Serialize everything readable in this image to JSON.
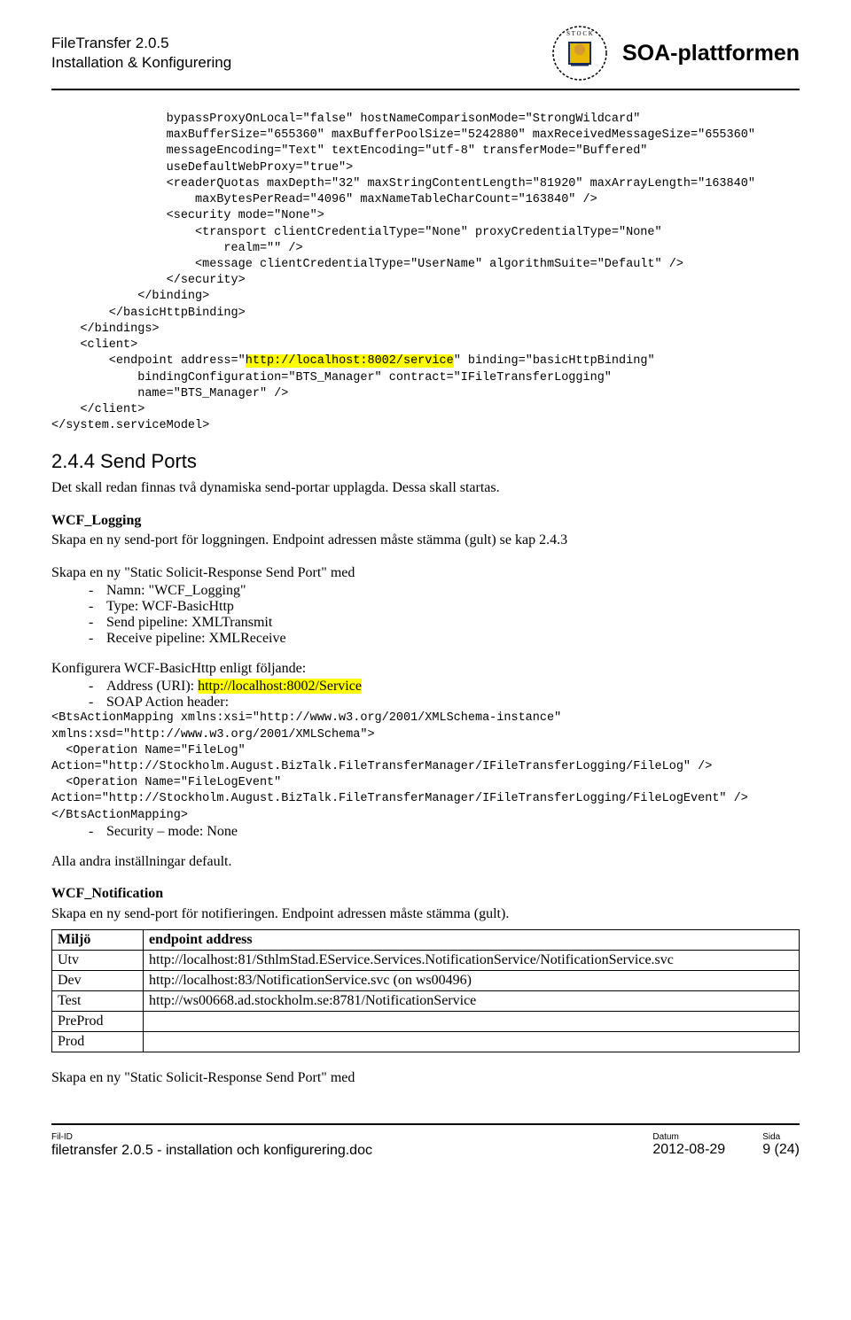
{
  "header": {
    "title_line1": "FileTransfer 2.0.5",
    "title_line2": "Installation & Konfigurering",
    "platform": "SOA-plattformen"
  },
  "code": {
    "pre1": "                bypassProxyOnLocal=\"false\" hostNameComparisonMode=\"StrongWildcard\"\n                maxBufferSize=\"655360\" maxBufferPoolSize=\"5242880\" maxReceivedMessageSize=\"655360\"\n                messageEncoding=\"Text\" textEncoding=\"utf-8\" transferMode=\"Buffered\"\n                useDefaultWebProxy=\"true\">\n                <readerQuotas maxDepth=\"32\" maxStringContentLength=\"81920\" maxArrayLength=\"163840\"\n                    maxBytesPerRead=\"4096\" maxNameTableCharCount=\"163840\" />\n                <security mode=\"None\">\n                    <transport clientCredentialType=\"None\" proxyCredentialType=\"None\"\n                        realm=\"\" />\n                    <message clientCredentialType=\"UserName\" algorithmSuite=\"Default\" />\n                </security>\n            </binding>\n        </basicHttpBinding>\n    </bindings>\n    <client>\n        <endpoint address=\"",
    "endpoint_hl": "http://localhost:8002/service",
    "post1": "\" binding=\"basicHttpBinding\"\n            bindingConfiguration=\"BTS_Manager\" contract=\"IFileTransferLogging\"\n            name=\"BTS_Manager\" />\n    </client>\n</system.serviceModel>"
  },
  "section_244": {
    "heading": "2.4.4   Send Ports",
    "intro": "Det skall redan finnas två dynamiska send-portar upplagda. Dessa skall startas.",
    "wcf_logging_title": "WCF_Logging",
    "wcf_logging_sub": "Skapa en ny send-port för loggningen. Endpoint adressen måste stämma (gult) se kap 2.4.3",
    "solicit_intro": "Skapa en ny \"Static Solicit-Response Send Port\" med",
    "bullets1": {
      "b1": "Namn: \"WCF_Logging\"",
      "b2": "Type: WCF-BasicHttp",
      "b3": "Send pipeline: XMLTransmit",
      "b4": "Receive pipeline: XMLReceive"
    },
    "konfig_title": "Konfigurera WCF-BasicHttp enligt följande:",
    "addr_label": "Address (URI): ",
    "addr_hl": "http://localhost:8002/Service",
    "soap_label": "SOAP Action header:",
    "soap_xml_1": "<BtsActionMapping xmlns:xsi=\"http://www.w3.org/2001/XMLSchema-instance\"\nxmlns:xsd=\"http://www.w3.org/2001/XMLSchema\">\n  <Operation Name=\"FileLog\"\nAction=\"http://Stockholm.August.BizTalk.FileTransferManager/IFileTransferLogging/FileLog\" />\n  <Operation Name=\"FileLogEvent\"\nAction=\"http://Stockholm.August.BizTalk.FileTransferManager/IFileTransferLogging/FileLogEvent\" />\n</BtsActionMapping>",
    "security_line": "Security – mode: None",
    "alla_default": "Alla andra inställningar default.",
    "wcf_notif_title": "WCF_Notification",
    "wcf_notif_sub": "Skapa en ny send-port för notifieringen. Endpoint adressen måste stämma (gult).",
    "table": {
      "col1": "Miljö",
      "col2": "endpoint address",
      "rows": [
        {
          "env": "Utv",
          "addr": "http://localhost:81/SthlmStad.EService.Services.NotificationService/NotificationService.svc"
        },
        {
          "env": "Dev",
          "addr": "http://localhost:83/NotificationService.svc (on ws00496)"
        },
        {
          "env": "Test",
          "addr": "http://ws00668.ad.stockholm.se:8781/NotificationService"
        },
        {
          "env": "PreProd",
          "addr": ""
        },
        {
          "env": "Prod",
          "addr": ""
        }
      ]
    },
    "solicit_outro": "Skapa en ny \"Static Solicit-Response Send Port\" med"
  },
  "footer": {
    "filid_label": "Fil-ID",
    "filename": "filetransfer 2.0.5 - installation och konfigurering.doc",
    "datum_label": "Datum",
    "datum": "2012-08-29",
    "sida_label": "Sida",
    "sida": "9 (24)"
  }
}
